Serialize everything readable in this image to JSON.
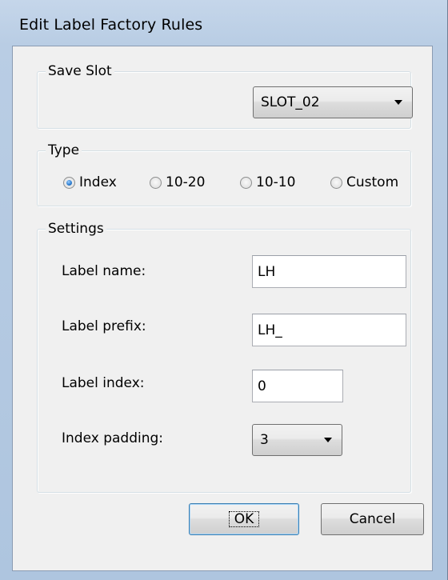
{
  "window": {
    "title": "Edit Label Factory Rules"
  },
  "save_slot": {
    "legend": "Save Slot",
    "selected": "SLOT_02"
  },
  "type": {
    "legend": "Type",
    "options": [
      {
        "label": "Index",
        "checked": true
      },
      {
        "label": "10-20",
        "checked": false
      },
      {
        "label": "10-10",
        "checked": false
      },
      {
        "label": "Custom",
        "checked": false
      }
    ]
  },
  "settings": {
    "legend": "Settings",
    "label_name": {
      "label": "Label name:",
      "value": "LH"
    },
    "label_prefix": {
      "label": "Label prefix:",
      "value": "LH_"
    },
    "label_index": {
      "label": "Label index:",
      "value": "0"
    },
    "index_padding": {
      "label": "Index padding:",
      "selected": "3"
    }
  },
  "buttons": {
    "ok": "OK",
    "cancel": "Cancel"
  }
}
